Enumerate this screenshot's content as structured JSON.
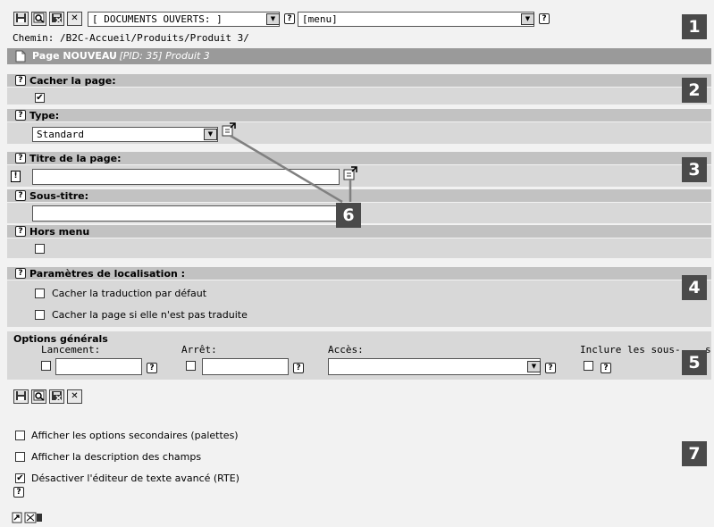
{
  "toolbar": {
    "buttons": [
      "save-icon",
      "save-view-icon",
      "save-close-icon",
      "close-icon"
    ],
    "close_glyph": "✕",
    "open_docs_select": "[ DOCUMENTS OUVERTS: ]",
    "menu_select": "[menu]"
  },
  "path": "Chemin: /B2C-Accueil/Produits/Produit 3/",
  "page_header": {
    "label": "Page NOUVEAU",
    "meta": "- [PID: 35] Produit 3"
  },
  "section_hide": {
    "label": "Cacher la page:",
    "checked_glyph": "✔"
  },
  "section_type": {
    "label": "Type:",
    "value": "Standard"
  },
  "section_title": {
    "label": "Titre de la page:",
    "required_marker": "!",
    "value": ""
  },
  "section_subtitle": {
    "label": "Sous-titre:",
    "value": ""
  },
  "section_nav_hide": {
    "label": "Hors menu"
  },
  "section_localization": {
    "label": "Paramètres de localisation :",
    "opt1": "Cacher la traduction par défaut",
    "opt2": "Cacher la page si elle n'est pas traduite"
  },
  "general_options": {
    "title": "Options générals",
    "start_label": "Lancement:",
    "stop_label": "Arrêt:",
    "access_label": "Accès:",
    "include_sub_label": "Inclure les sous-",
    "include_sub_tail": "s"
  },
  "bottom_options": {
    "opt1": "Afficher les options secondaires (palettes)",
    "opt2": "Afficher la description des champs",
    "opt3": "Désactiver l'éditeur de texte avancé (RTE)",
    "opt3_glyph": "✔"
  },
  "help_glyph": "?",
  "dropdown_glyph": "▼",
  "badges": [
    "1",
    "2",
    "3",
    "4",
    "5",
    "6",
    "7"
  ],
  "colors": {
    "badge": "#4a4a4a",
    "header_band": "#c2c2c2",
    "content_band": "#d8d8d8",
    "background": "#f2f2f2",
    "callout_line": "#808080"
  }
}
